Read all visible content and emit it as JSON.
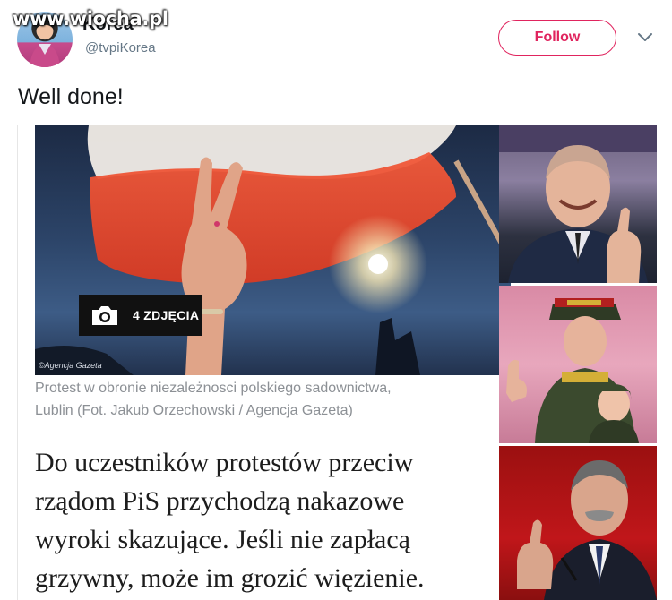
{
  "header": {
    "watermark": "www.wiocha.pl",
    "display_name": "Korea",
    "handle": "@tvpiKorea",
    "follow_label": "Follow"
  },
  "tweet": {
    "text": "Well done!"
  },
  "article": {
    "photo_badge_label": "4 ZDJĘCIA",
    "photo_credit": "©Agencja Gazeta",
    "caption_line1": "Protest w obronie niezależnosci polskiego sadownictwa,",
    "caption_line2": "Lublin (Fot. Jakub Orzechowski / Agencja Gazeta)",
    "headline_line1": "Do uczestników protestów przeciw",
    "headline_line2": "rządom PiS przychodzą nakazowe",
    "headline_line3": "wyroki skazujące. Jeśli nie zapłacą",
    "headline_line4": "grzywny, może im grozić więzienie."
  },
  "colors": {
    "follow_accent": "#e0245e",
    "handle_gray": "#657786",
    "caption_gray": "#8c9095"
  },
  "icons": [
    "chevron-down-icon",
    "camera-icon"
  ]
}
